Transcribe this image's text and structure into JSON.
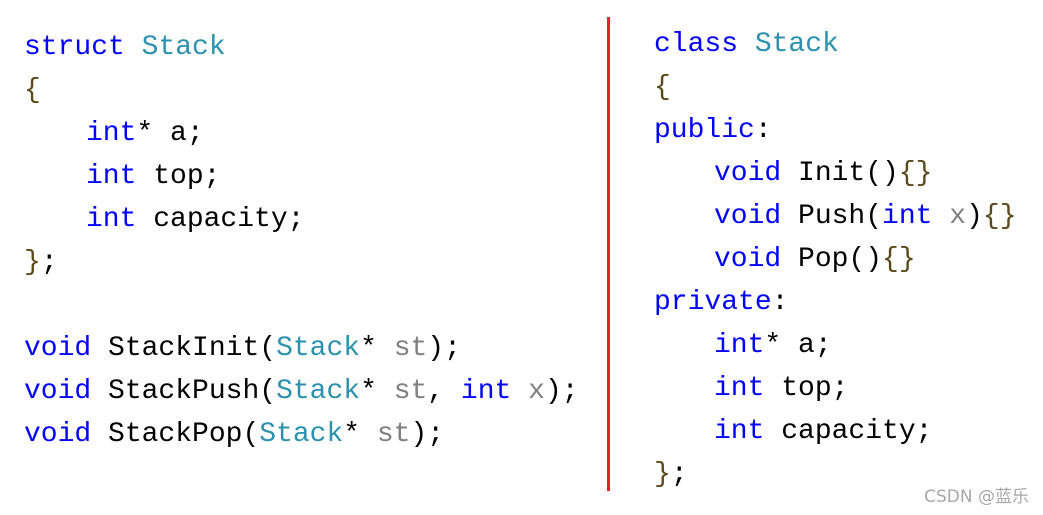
{
  "colors": {
    "keyword": "#0000ff",
    "type": "#2b91af",
    "param": "#808080",
    "text": "#000000",
    "brace": "#5a4a1a",
    "divider": "#e8202a"
  },
  "left_code": [
    {
      "indent": 0,
      "tokens": [
        {
          "t": "struct",
          "k": "keyword"
        },
        {
          "t": " ",
          "k": "text"
        },
        {
          "t": "Stack",
          "k": "type"
        }
      ]
    },
    {
      "indent": 0,
      "tokens": [
        {
          "t": "{",
          "k": "brace"
        }
      ]
    },
    {
      "indent": 1,
      "tokens": [
        {
          "t": "int",
          "k": "keyword"
        },
        {
          "t": "* a;",
          "k": "text"
        }
      ]
    },
    {
      "indent": 1,
      "tokens": [
        {
          "t": "int",
          "k": "keyword"
        },
        {
          "t": " top;",
          "k": "text"
        }
      ]
    },
    {
      "indent": 1,
      "tokens": [
        {
          "t": "int",
          "k": "keyword"
        },
        {
          "t": " capacity;",
          "k": "text"
        }
      ]
    },
    {
      "indent": 0,
      "tokens": [
        {
          "t": "}",
          "k": "brace"
        },
        {
          "t": ";",
          "k": "text"
        }
      ]
    },
    {
      "indent": 0,
      "tokens": []
    },
    {
      "indent": 0,
      "tokens": [
        {
          "t": "void",
          "k": "keyword"
        },
        {
          "t": " StackInit(",
          "k": "text"
        },
        {
          "t": "Stack",
          "k": "type"
        },
        {
          "t": "* ",
          "k": "text"
        },
        {
          "t": "st",
          "k": "param"
        },
        {
          "t": ");",
          "k": "text"
        }
      ]
    },
    {
      "indent": 0,
      "tokens": [
        {
          "t": "void",
          "k": "keyword"
        },
        {
          "t": " StackPush(",
          "k": "text"
        },
        {
          "t": "Stack",
          "k": "type"
        },
        {
          "t": "* ",
          "k": "text"
        },
        {
          "t": "st",
          "k": "param"
        },
        {
          "t": ", ",
          "k": "text"
        },
        {
          "t": "int",
          "k": "keyword"
        },
        {
          "t": " ",
          "k": "text"
        },
        {
          "t": "x",
          "k": "param"
        },
        {
          "t": ");",
          "k": "text"
        }
      ]
    },
    {
      "indent": 0,
      "tokens": [
        {
          "t": "void",
          "k": "keyword"
        },
        {
          "t": " StackPop(",
          "k": "text"
        },
        {
          "t": "Stack",
          "k": "type"
        },
        {
          "t": "* ",
          "k": "text"
        },
        {
          "t": "st",
          "k": "param"
        },
        {
          "t": ");",
          "k": "text"
        }
      ]
    }
  ],
  "right_code": [
    {
      "indent": 0,
      "tokens": [
        {
          "t": "class",
          "k": "keyword"
        },
        {
          "t": " ",
          "k": "text"
        },
        {
          "t": "Stack",
          "k": "type"
        }
      ]
    },
    {
      "indent": 0,
      "tokens": [
        {
          "t": "{",
          "k": "brace"
        }
      ]
    },
    {
      "indent": 0,
      "tokens": [
        {
          "t": "public",
          "k": "keyword"
        },
        {
          "t": ":",
          "k": "text"
        }
      ]
    },
    {
      "indent": 1,
      "tokens": [
        {
          "t": "void",
          "k": "keyword"
        },
        {
          "t": " Init()",
          "k": "text"
        },
        {
          "t": "{}",
          "k": "brace"
        }
      ]
    },
    {
      "indent": 1,
      "tokens": [
        {
          "t": "void",
          "k": "keyword"
        },
        {
          "t": " Push(",
          "k": "text"
        },
        {
          "t": "int",
          "k": "keyword"
        },
        {
          "t": " ",
          "k": "text"
        },
        {
          "t": "x",
          "k": "param"
        },
        {
          "t": ")",
          "k": "text"
        },
        {
          "t": "{}",
          "k": "brace"
        }
      ]
    },
    {
      "indent": 1,
      "tokens": [
        {
          "t": "void",
          "k": "keyword"
        },
        {
          "t": " Pop()",
          "k": "text"
        },
        {
          "t": "{}",
          "k": "brace"
        }
      ]
    },
    {
      "indent": 0,
      "tokens": [
        {
          "t": "private",
          "k": "keyword"
        },
        {
          "t": ":",
          "k": "text"
        }
      ]
    },
    {
      "indent": 1,
      "tokens": [
        {
          "t": "int",
          "k": "keyword"
        },
        {
          "t": "* a;",
          "k": "text"
        }
      ]
    },
    {
      "indent": 1,
      "tokens": [
        {
          "t": "int",
          "k": "keyword"
        },
        {
          "t": " top;",
          "k": "text"
        }
      ]
    },
    {
      "indent": 1,
      "tokens": [
        {
          "t": "int",
          "k": "keyword"
        },
        {
          "t": " capacity;",
          "k": "text"
        }
      ]
    },
    {
      "indent": 0,
      "tokens": [
        {
          "t": "}",
          "k": "brace"
        },
        {
          "t": ";",
          "k": "text"
        }
      ]
    }
  ],
  "watermark": "CSDN @蓝乐"
}
